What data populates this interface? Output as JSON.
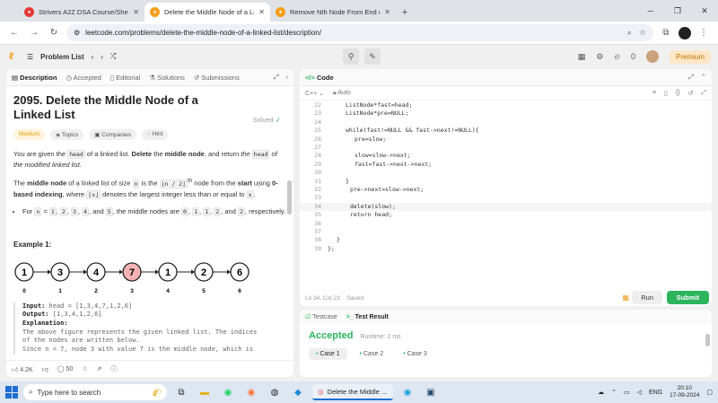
{
  "browser": {
    "tabs": [
      {
        "label": "Strivers A2Z DSA Course/Sheet",
        "favicon_color": "#e53935",
        "active": false
      },
      {
        "label": "Delete the Middle Node of a Li",
        "favicon_color": "#f89f1b",
        "active": true
      },
      {
        "label": "Remove Nth Node From End of",
        "favicon_color": "#f89f1b",
        "active": false
      }
    ],
    "url": "leetcode.com/problems/delete-the-middle-node-of-a-linked-list/description/"
  },
  "lc_nav": {
    "problem_list": "Problem List",
    "premium": "Premium",
    "streak": "0"
  },
  "left_panel": {
    "tabs": [
      "Description",
      "Accepted",
      "Editorial",
      "Solutions",
      "Submissions"
    ],
    "title": "2095. Delete the Middle Node of a Linked List",
    "solved": "Solved",
    "badges": [
      "Medium",
      "Topics",
      "Companies",
      "Hint"
    ],
    "p1_a": "You are given the ",
    "p1_code": "head",
    "p1_b": " of a linked list. ",
    "p1_bold1": "Delete",
    "p1_c": " the ",
    "p1_bold2": "middle node",
    "p1_d": ", and return ",
    "p1_em1": "the ",
    "p1_code2": "head",
    "p1_em2": " of the modified linked list.",
    "p2_a": "The ",
    "p2_bold1": "middle node",
    "p2_b": " of a linked list of size ",
    "p2_code1": "n",
    "p2_c": " is the ",
    "p2_code2": "⌊n / 2⌋",
    "p2_sup": "th",
    "p2_d": " node from the ",
    "p2_bold2": "start",
    "p2_e": " using ",
    "p2_bold3": "0-based indexing",
    "p2_f": ", where ",
    "p2_code3": "⌊x⌋",
    "p2_g": " denotes the largest integer less than or equal to ",
    "p2_code4": "x",
    "p2_h": ".",
    "li_a": "For ",
    "li_c1": "n",
    "li_b": " = ",
    "li_c2": "1",
    "li_c3": "2",
    "li_c4": "3",
    "li_c5": "4",
    "li_and": ", and ",
    "li_c6": "5",
    "li_d": ", the middle nodes are ",
    "li_c7": "0",
    "li_c8": "1",
    "li_c9": "1",
    "li_c10": "2",
    "li_c11": "2",
    "li_e": ", respectively.",
    "example_title": "Example 1:",
    "diagram": {
      "nodes": [
        "1",
        "3",
        "4",
        "7",
        "1",
        "2",
        "6"
      ],
      "indices": [
        "0",
        "1",
        "2",
        "3",
        "4",
        "5",
        "6"
      ],
      "highlight_index": 3,
      "highlight_color": "#f7b3b3"
    },
    "input_label": "Input:",
    "input_value": "head = [1,3,4,7,1,2,6]",
    "output_label": "Output:",
    "output_value": "[1,3,4,1,2,6]",
    "explanation_label": "Explanation:",
    "explanation_lines": [
      "The above figure represents the given linked list. The indices",
      "of the nodes are written below.",
      "Since n = 7, node 3 with value 7 is the middle node, which is"
    ],
    "likes": "4.2K",
    "comments": "50"
  },
  "code_panel": {
    "title": "Code",
    "language": "C++",
    "mode": "Auto",
    "lines": [
      {
        "n": "22",
        "indent": 4,
        "text": "ListNode*fast=head;"
      },
      {
        "n": "23",
        "indent": 4,
        "text": "ListNode*pre=NULL;"
      },
      {
        "n": "24",
        "indent": 0,
        "text": ""
      },
      {
        "n": "25",
        "indent": 4,
        "text": "while(fast!=NULL && fast->next!=NULL){"
      },
      {
        "n": "26",
        "indent": 6,
        "text": "pre=slow;"
      },
      {
        "n": "27",
        "indent": 0,
        "text": ""
      },
      {
        "n": "28",
        "indent": 6,
        "text": "slow=slow->next;"
      },
      {
        "n": "29",
        "indent": 6,
        "text": "fast=fast->next->next;"
      },
      {
        "n": "30",
        "indent": 0,
        "text": ""
      },
      {
        "n": "31",
        "indent": 4,
        "text": "}"
      },
      {
        "n": "32",
        "indent": 5,
        "text": "pre->next=slow->next;"
      },
      {
        "n": "33",
        "indent": 0,
        "text": ""
      },
      {
        "n": "34",
        "indent": 5,
        "text": "delete(slow);"
      },
      {
        "n": "35",
        "indent": 5,
        "text": "return head;"
      },
      {
        "n": "36",
        "indent": 0,
        "text": ""
      },
      {
        "n": "37",
        "indent": 0,
        "text": ""
      },
      {
        "n": "38",
        "indent": 2,
        "text": "}"
      },
      {
        "n": "39",
        "indent": 0,
        "text": "};"
      }
    ],
    "status": "Ln 34, Col 23",
    "saved": "Saved",
    "run": "Run",
    "submit": "Submit"
  },
  "result_panel": {
    "tabs": [
      "Testcase",
      "Test Result"
    ],
    "verdict": "Accepted",
    "runtime": "Runtime: 2 ms",
    "cases": [
      "Case 1",
      "Case 2",
      "Case 3"
    ]
  },
  "taskbar": {
    "search_placeholder": "Type here to search",
    "chrome_label": "Delete the Middle ...",
    "lang": "ENG",
    "time": "20:10",
    "date": "17-09-2024"
  }
}
